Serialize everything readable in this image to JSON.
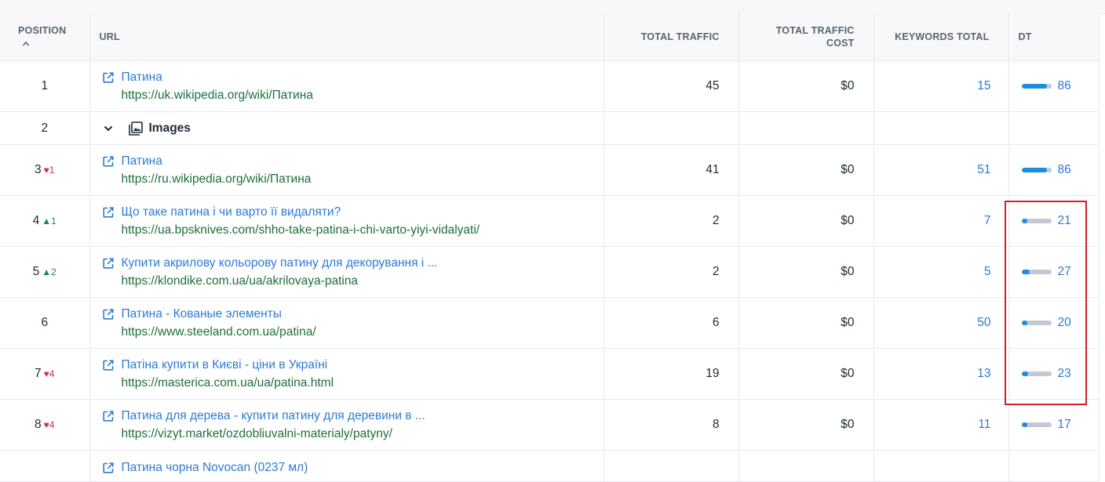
{
  "table": {
    "columns": {
      "position": "POSITION",
      "url": "URL",
      "total_traffic": "TOTAL TRAFFIC",
      "total_traffic_cost_line1": "TOTAL TRAFFIC",
      "total_traffic_cost_line2": "COST",
      "keywords_total": "KEYWORDS TOTAL",
      "dt": "DT"
    },
    "sort_indicator": "^",
    "rows": [
      {
        "position": "1",
        "change": "",
        "title": "Патина",
        "url": "https://uk.wikipedia.org/wiki/Патина",
        "traffic": "45",
        "cost": "$0",
        "keywords": "15",
        "dt": 86
      },
      {
        "position": "3",
        "change": "1",
        "title": "Патина",
        "url": "https://ru.wikipedia.org/wiki/Патина",
        "traffic": "41",
        "cost": "$0",
        "keywords": "51",
        "dt": 86
      },
      {
        "position": "4",
        "change": "1",
        "title": "Що таке патина і чи варто її видаляти?",
        "url": "https://ua.bpsknives.com/shho-take-patina-i-chi-varto-yiyi-vidalyati/",
        "traffic": "2",
        "cost": "$0",
        "keywords": "7",
        "dt": 21
      },
      {
        "position": "5",
        "change": "2",
        "title": "Купити акрилову кольорову патину для декорування і ...",
        "url": "https://klondike.com.ua/ua/akrilovaya-patina",
        "traffic": "2",
        "cost": "$0",
        "keywords": "5",
        "dt": 27
      },
      {
        "position": "6",
        "change": "",
        "title": "Патина - Кованые элементы",
        "url": "https://www.steeland.com.ua/patina/",
        "traffic": "6",
        "cost": "$0",
        "keywords": "50",
        "dt": 20
      },
      {
        "position": "7",
        "change": "4",
        "title": "Патіна купити в Києві - ціни в Україні",
        "url": "https://masterica.com.ua/ua/patina.html",
        "traffic": "19",
        "cost": "$0",
        "keywords": "13",
        "dt": 23
      },
      {
        "position": "8",
        "change": "4",
        "title": "Патина для дерева - купити патину для деревини в ...",
        "url": "https://vizyt.market/ozdobliuvalni-materialy/patyny/",
        "traffic": "8",
        "cost": "$0",
        "keywords": "11",
        "dt": 17
      },
      {
        "position": "",
        "change": "",
        "title": "Патина чорна Novocan (0237 мл)",
        "url": "",
        "traffic": "",
        "cost": "",
        "keywords": "",
        "dt": null
      }
    ],
    "images_row": {
      "position": "2",
      "label": "Images"
    }
  },
  "colors": {
    "link": "#2d7ad6",
    "url_green": "#1e6f3a",
    "down_red": "#d32f3a",
    "up_green": "#1f8a4c",
    "dt_fill": "#1c8ee0",
    "highlight": "#d61c24"
  }
}
